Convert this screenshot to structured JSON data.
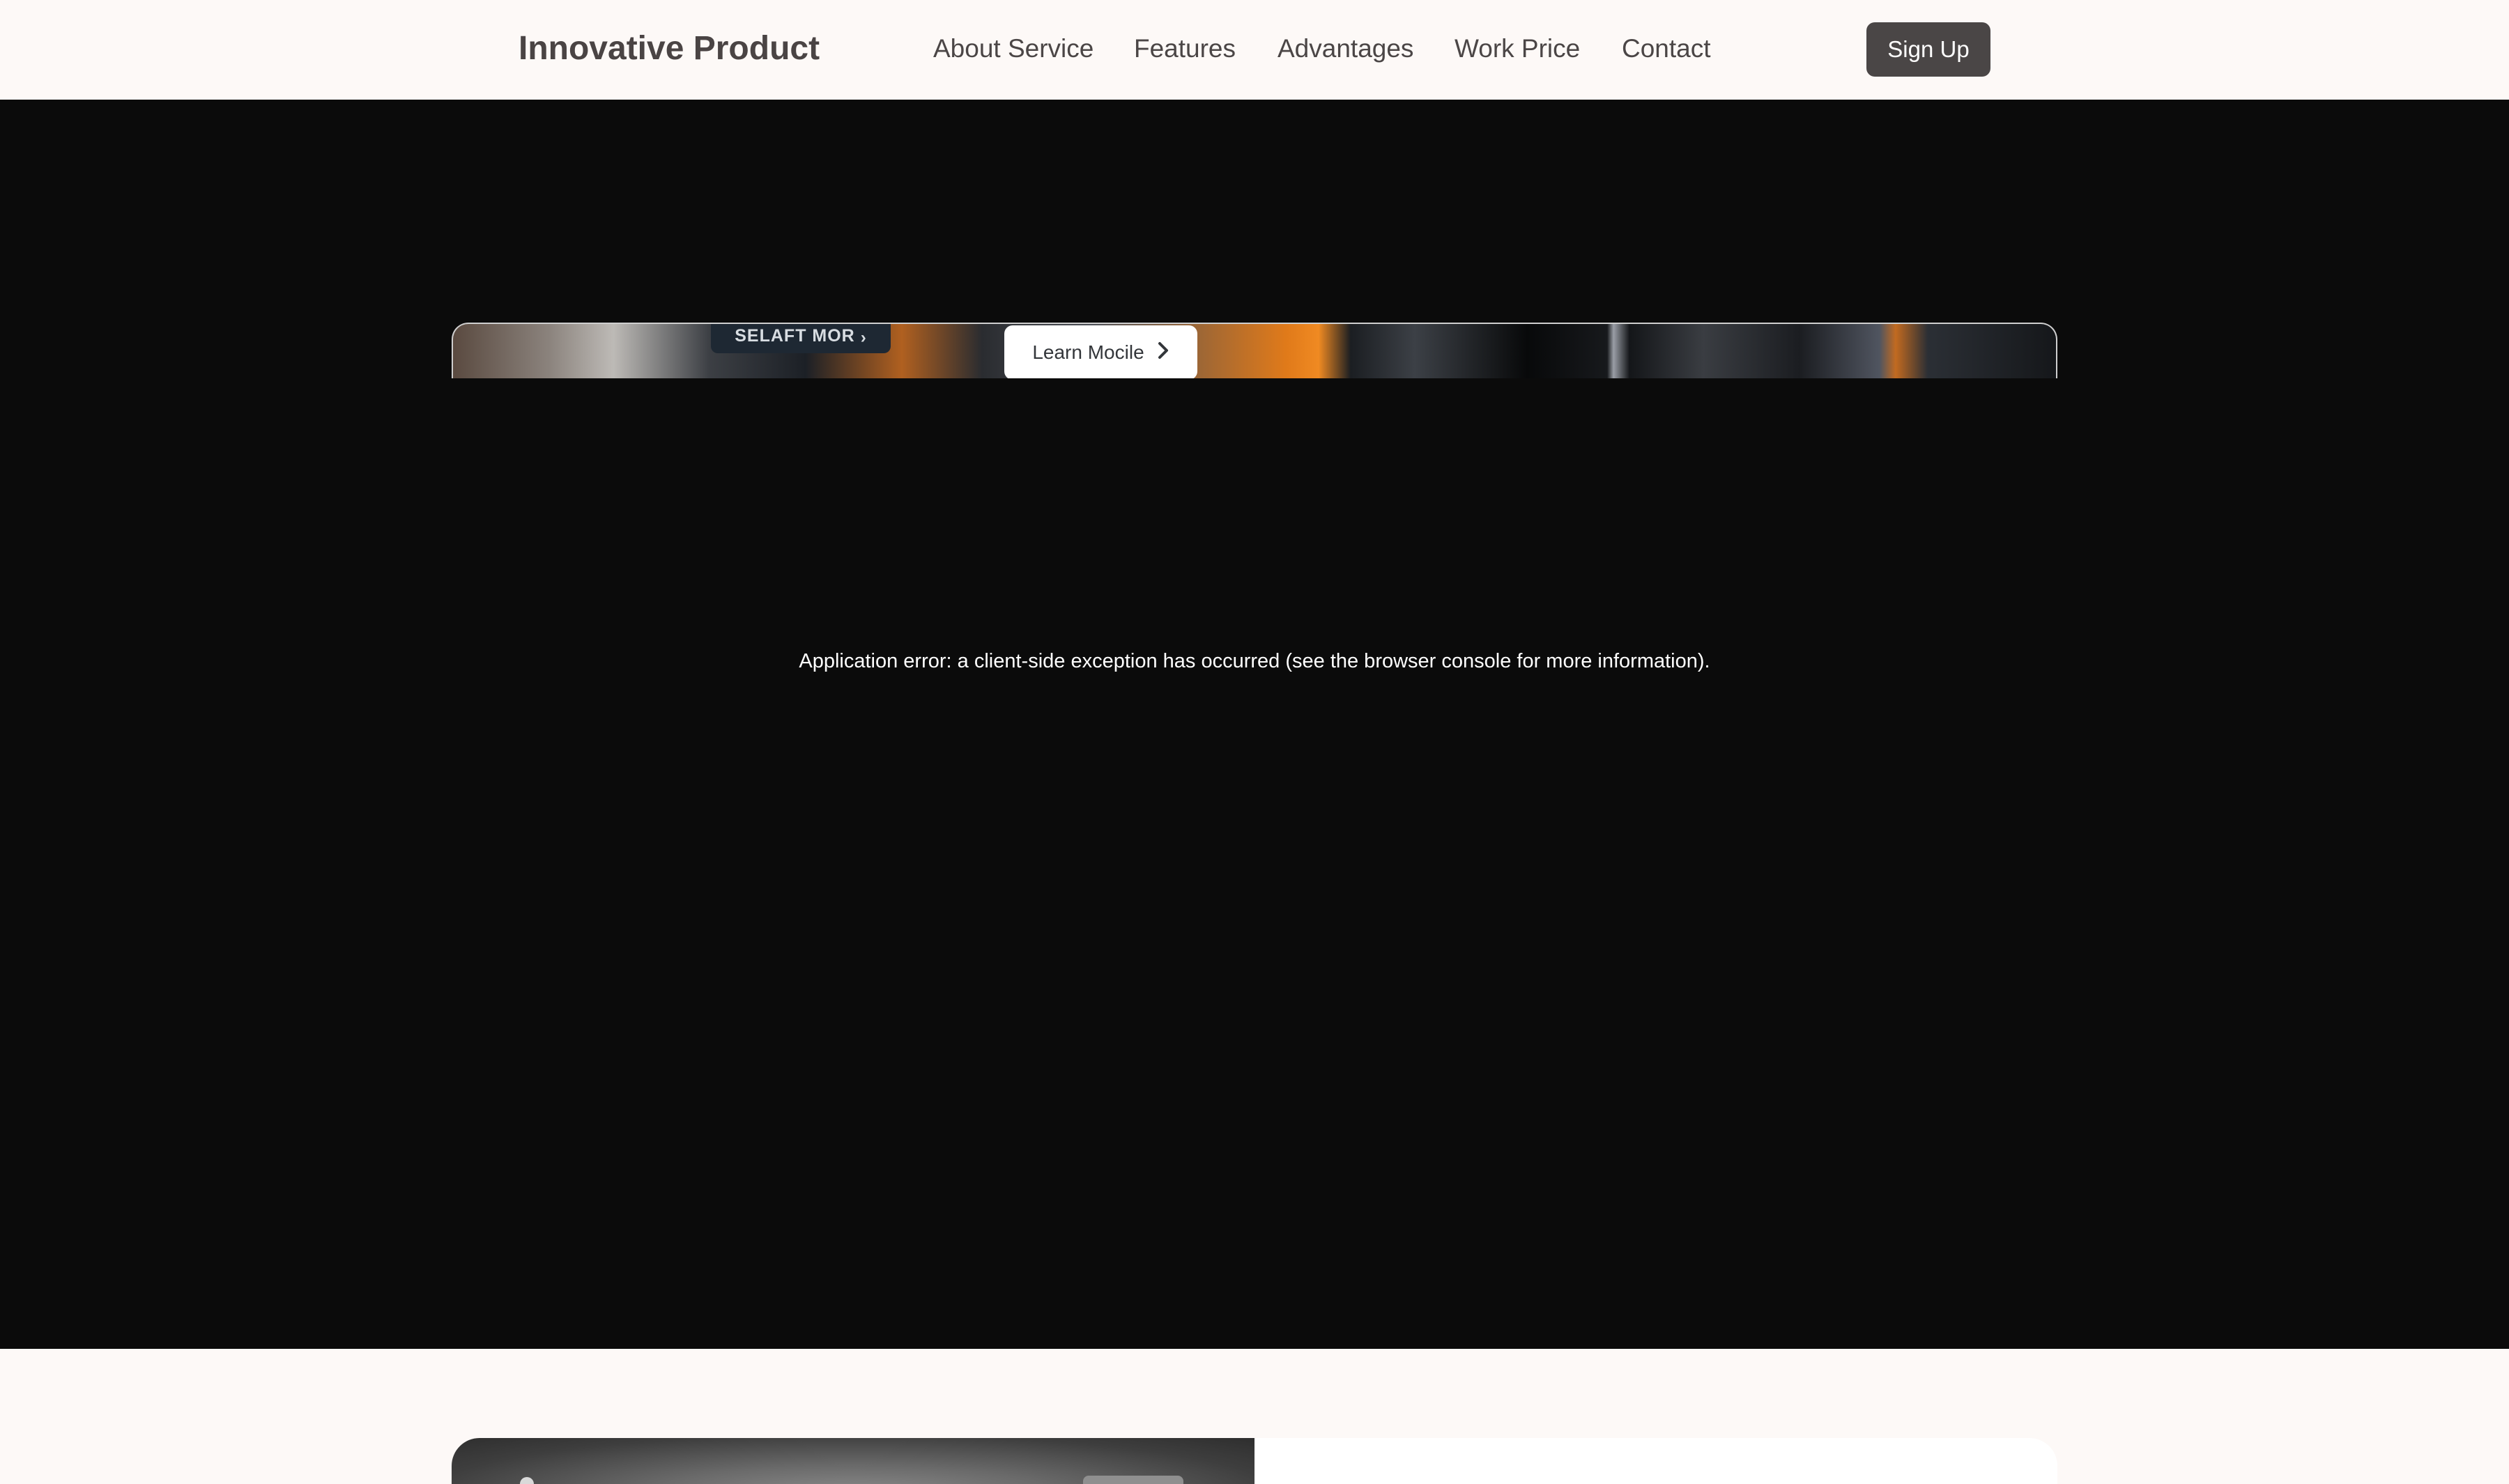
{
  "header": {
    "brand": "Innovative Product",
    "nav": [
      {
        "label": "About Service"
      },
      {
        "label": "Features"
      },
      {
        "label": "Advantages"
      },
      {
        "label": "Work Price"
      },
      {
        "label": "Contact"
      }
    ],
    "signup_label": "Sign Up"
  },
  "hero": {
    "media": {
      "dark_button_label": "SELAFT MOR",
      "light_button_label": "Learn Mocile",
      "icon": "chevron-right-icon"
    },
    "error_message": "Application error: a client-side exception has occurred (see the browser console for more information)."
  },
  "colors": {
    "background": "#fdf9f7",
    "hero_background": "#0b0b0b",
    "signup_button": "#4a4646",
    "accent_orange": "#f08a22"
  }
}
